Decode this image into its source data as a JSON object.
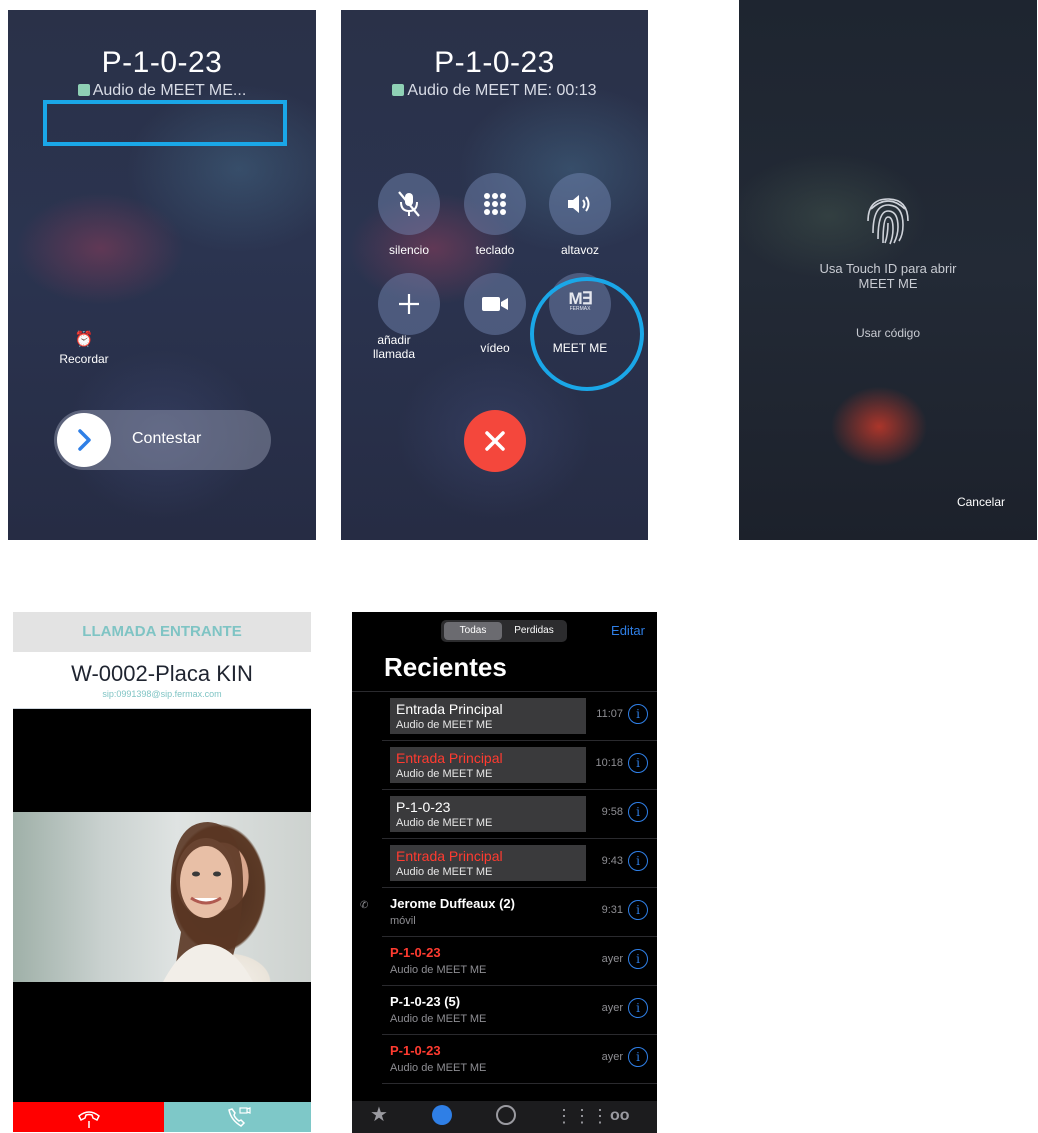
{
  "panel1": {
    "title": "P-1-0-23",
    "subtitle": "Audio de MEET ME...",
    "remind_label": "Recordar",
    "answer_label": "Contestar"
  },
  "panel2": {
    "title": "P-1-0-23",
    "subtitle": "Audio de MEET ME: 00:13",
    "buttons": [
      {
        "label": "silencio"
      },
      {
        "label": "teclado"
      },
      {
        "label": "altavoz"
      },
      {
        "label": "añadir llamada"
      },
      {
        "label": "vídeo"
      },
      {
        "label": "MEET ME"
      }
    ],
    "logo_text": "FERMAX"
  },
  "panel3": {
    "touchid_text": "Usa Touch ID para abrir MEET ME",
    "use_code": "Usar código",
    "cancel": "Cancelar"
  },
  "panel4": {
    "header": "LLAMADA ENTRANTE",
    "caller": "W-0002-Placa KIN",
    "sip": "sip:0991398@sip.fermax.com",
    "colors": {
      "header_text": "#7fc4c4",
      "reject": "#ff0000",
      "accept": "#7ec8c8"
    }
  },
  "panel5": {
    "seg_all": "Todas",
    "seg_missed": "Perdidas",
    "edit": "Editar",
    "title": "Recientes",
    "rows": [
      {
        "name": "Entrada Principal",
        "desc": "Audio de MEET ME",
        "time": "11:07",
        "missed": false
      },
      {
        "name": "Entrada Principal",
        "desc": "Audio de MEET ME",
        "time": "10:18",
        "missed": true
      },
      {
        "name": "P-1-0-23",
        "desc": "Audio de MEET ME",
        "time": "9:58",
        "missed": false
      },
      {
        "name": "Entrada Principal",
        "desc": "Audio de MEET ME",
        "time": "9:43",
        "missed": true
      },
      {
        "name": "Jerome Duffeaux (2)",
        "desc": "móvil",
        "time": "9:31",
        "missed": false
      },
      {
        "name": "P-1-0-23",
        "desc": "Audio de MEET ME",
        "time": "ayer",
        "missed": true
      },
      {
        "name": "P-1-0-23 (5)",
        "desc": "Audio de MEET ME",
        "time": "ayer",
        "missed": false
      },
      {
        "name": "P-1-0-23",
        "desc": "Audio de MEET ME",
        "time": "ayer",
        "missed": true
      }
    ],
    "tabs": [
      "star-icon",
      "clock-icon",
      "contacts-icon",
      "keypad-icon",
      "voicemail-icon"
    ],
    "accent": "#2f7fe6"
  }
}
